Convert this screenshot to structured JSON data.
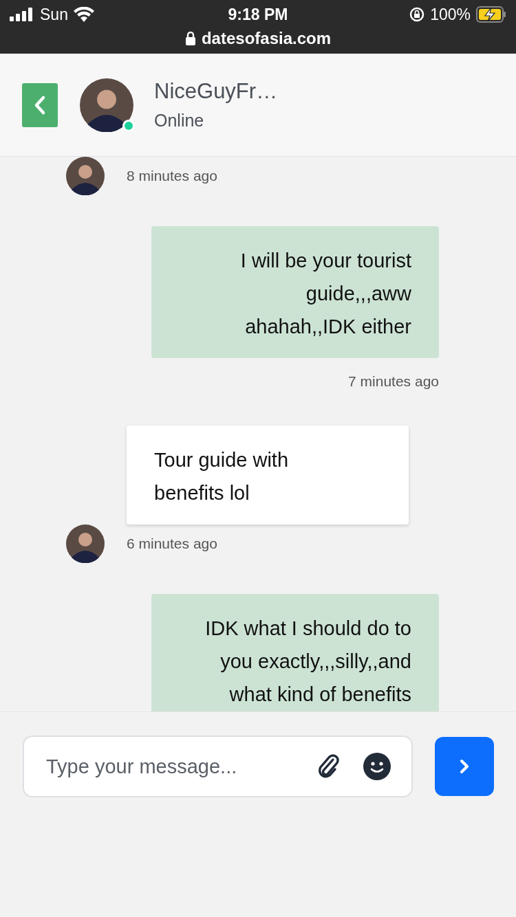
{
  "status_bar": {
    "carrier": "Sun",
    "time": "9:18 PM",
    "url": "datesofasia.com",
    "battery": "100%",
    "charging": true
  },
  "header": {
    "name": "NiceGuyFr…",
    "status": "Online",
    "online": true
  },
  "messages": [
    {
      "kind": "received",
      "time": "8 minutes ago"
    },
    {
      "kind": "sent",
      "text": "I will be your tourist guide,,,aww ahahah,,IDK either",
      "time": "7 minutes ago"
    },
    {
      "kind": "received",
      "text": "Tour guide with benefits lol",
      "time": "6 minutes ago"
    },
    {
      "kind": "sent",
      "text": "IDK what I should do to you exactly,,,silly,,and what kind of benefits"
    }
  ],
  "composer": {
    "placeholder": "Type your message..."
  }
}
